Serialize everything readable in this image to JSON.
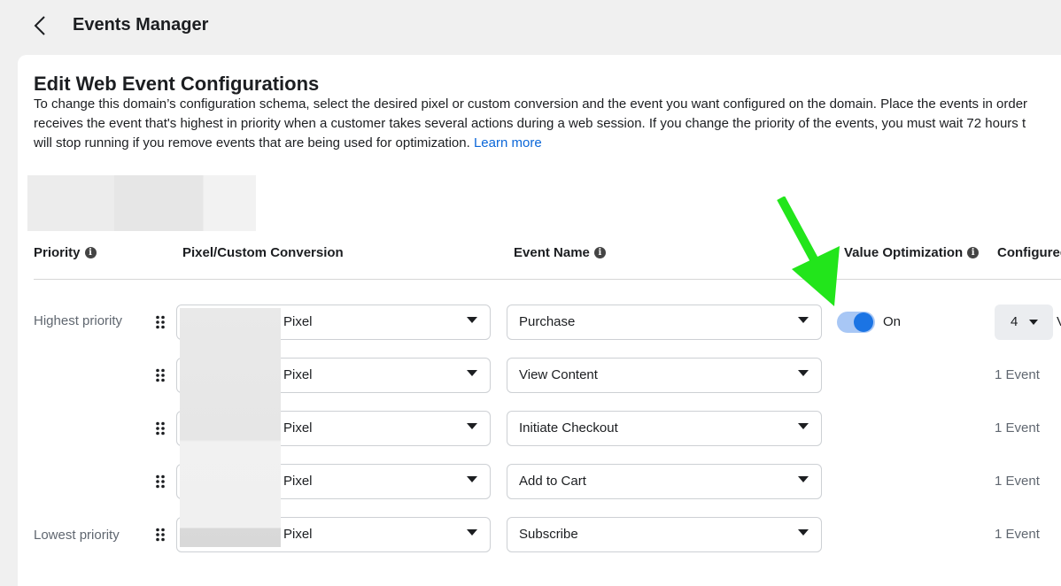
{
  "header": {
    "back_icon": "chevron-left-icon",
    "title": "Events Manager"
  },
  "page": {
    "title": "Edit Web Event Configurations",
    "description_lines": [
      "To change this domain’s configuration schema, select the desired pixel or custom conversion and the event you want configured on the domain. Place the events in order",
      "receives the event that's highest in priority when a customer takes several actions during a web session. If you change the priority of the events, you must wait 72 hours t",
      "will stop running if you remove events that are being used for optimization."
    ],
    "learn_more": "Learn more"
  },
  "columns": {
    "priority": "Priority",
    "pixel": "Pixel/Custom Conversion",
    "event_name": "Event Name",
    "value_optimization": "Value Optimization",
    "configured": "Configured"
  },
  "rows": [
    {
      "priority_label": "Highest priority",
      "pixel": "Pixel",
      "event": "Purchase",
      "value_opt": "On",
      "configured_value": "4",
      "configured_suffix": "V"
    },
    {
      "priority_label": "",
      "pixel": "Pixel",
      "event": "View Content",
      "configured_text": "1 Event"
    },
    {
      "priority_label": "",
      "pixel": "Pixel",
      "event": "Initiate Checkout",
      "configured_text": "1 Event"
    },
    {
      "priority_label": "",
      "pixel": "Pixel",
      "event": "Add to Cart",
      "configured_text": "1 Event"
    },
    {
      "priority_label": "Lowest priority",
      "pixel": "Pixel",
      "event": "Subscribe",
      "configured_text": "1 Event"
    }
  ],
  "colors": {
    "accent": "#1b74e4",
    "link": "#0a66d8",
    "annotation_arrow": "#22e51b"
  },
  "annotations": {
    "arrow_icon": "green-arrow-annotation"
  }
}
